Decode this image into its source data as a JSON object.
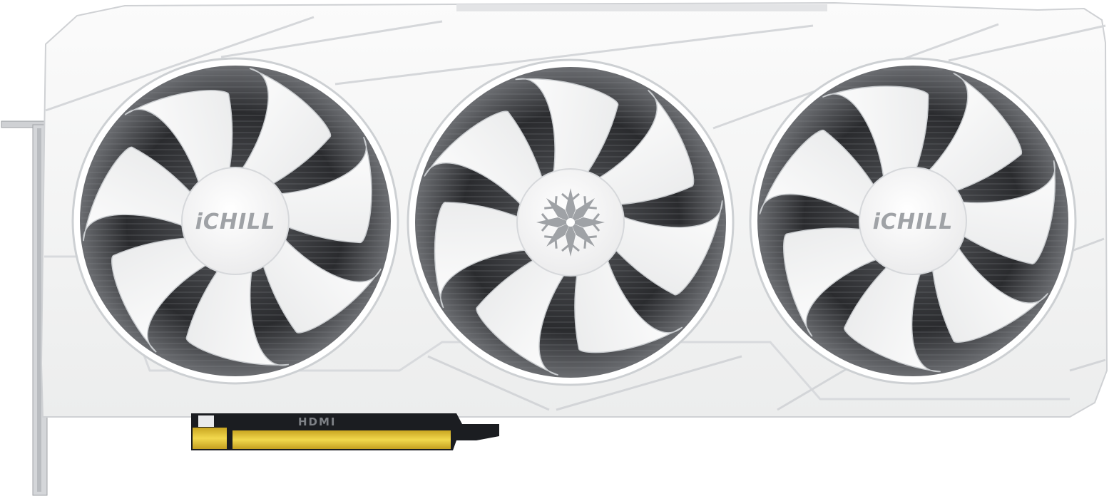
{
  "product": {
    "fan_hub_left_label": "iCHILL",
    "fan_hub_right_label": "iCHILL",
    "fan_hub_center_icon": "snowflake-logo-icon",
    "port_label": "HDMI",
    "fan_count": 3
  },
  "colors": {
    "shroud": "#f4f4f5",
    "shroud_shadow": "#d9dadc",
    "fan_blade": "#fbfbfb",
    "heatsink": "#3a3a3c",
    "pcb": "#1b1d21",
    "gold_contacts": "#e2c233",
    "logo_gray": "#9fa2a6"
  }
}
